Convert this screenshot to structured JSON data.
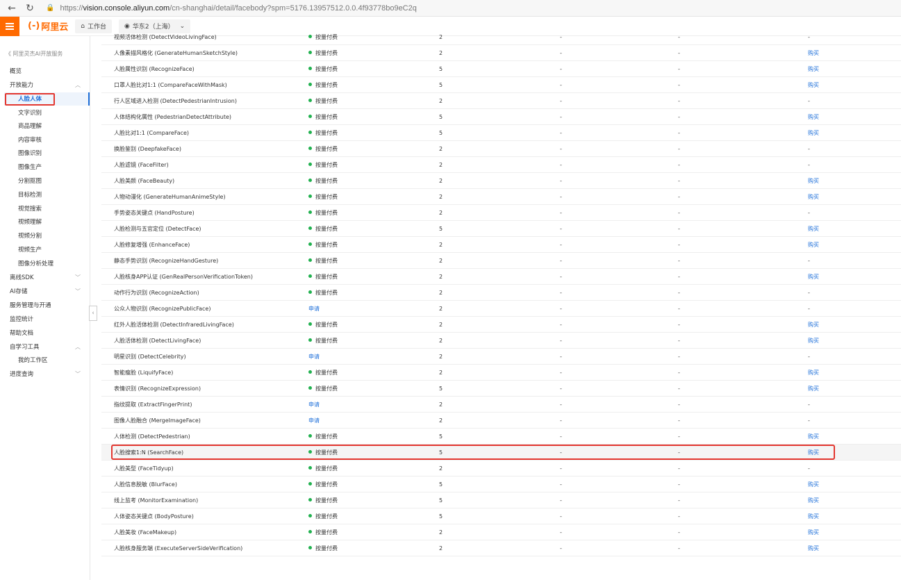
{
  "browser": {
    "url_prefix": "https://",
    "url_host": "vision.console.aliyun.com",
    "url_rest": "/cn-shanghai/detail/facebody?spm=5176.13957512.0.0.4f93778bo9eC2q"
  },
  "topbar": {
    "logo_mark": "(-)",
    "logo_text": "阿里云",
    "workbench": "工作台",
    "region": "华东2（上海）"
  },
  "sidebar": {
    "back": "《 阿里灵杰AI开放服务",
    "items": [
      {
        "label": "概览",
        "child": false
      },
      {
        "label": "开放能力",
        "child": false,
        "arrow": "︿"
      },
      {
        "label": "人脸人体",
        "child": true,
        "active": true
      },
      {
        "label": "文字识别",
        "child": true
      },
      {
        "label": "商品理解",
        "child": true
      },
      {
        "label": "内容审核",
        "child": true
      },
      {
        "label": "图像识别",
        "child": true
      },
      {
        "label": "图像生产",
        "child": true
      },
      {
        "label": "分割抠图",
        "child": true
      },
      {
        "label": "目标检测",
        "child": true
      },
      {
        "label": "视觉搜索",
        "child": true
      },
      {
        "label": "视频理解",
        "child": true
      },
      {
        "label": "视频分割",
        "child": true
      },
      {
        "label": "视频生产",
        "child": true
      },
      {
        "label": "图像分析处理",
        "child": true
      },
      {
        "label": "离线SDK",
        "child": false,
        "arrow": "﹀"
      },
      {
        "label": "AI存储",
        "child": false,
        "arrow": "﹀"
      },
      {
        "label": "服务管理与开通",
        "child": false
      },
      {
        "label": "监控统计",
        "child": false
      },
      {
        "label": "帮助文档",
        "child": false
      },
      {
        "label": "自学习工具",
        "child": false,
        "arrow": "︿"
      },
      {
        "label": "我的工作区",
        "child": true
      },
      {
        "label": "进度查询",
        "child": false,
        "arrow": "﹀"
      }
    ]
  },
  "table": {
    "rows": [
      {
        "name": "视频活体检测 (DetectVideoLivingFace)",
        "bill": "按量付费",
        "paid": true,
        "qps": "2",
        "d1": "-",
        "d2": "-",
        "buy": "-"
      },
      {
        "name": "人像素描风格化 (GenerateHumanSketchStyle)",
        "bill": "按量付费",
        "paid": true,
        "qps": "2",
        "d1": "-",
        "d2": "-",
        "buy": "购买"
      },
      {
        "name": "人脸属性识别 (RecognizeFace)",
        "bill": "按量付费",
        "paid": true,
        "qps": "5",
        "d1": "-",
        "d2": "-",
        "buy": "购买"
      },
      {
        "name": "口罩人脸比对1:1 (CompareFaceWithMask)",
        "bill": "按量付费",
        "paid": true,
        "qps": "5",
        "d1": "-",
        "d2": "-",
        "buy": "购买"
      },
      {
        "name": "行人区域进入检测 (DetectPedestrianIntrusion)",
        "bill": "按量付费",
        "paid": true,
        "qps": "2",
        "d1": "-",
        "d2": "-",
        "buy": "-"
      },
      {
        "name": "人体结构化属性 (PedestrianDetectAttribute)",
        "bill": "按量付费",
        "paid": true,
        "qps": "5",
        "d1": "-",
        "d2": "-",
        "buy": "购买"
      },
      {
        "name": "人脸比对1:1 (CompareFace)",
        "bill": "按量付费",
        "paid": true,
        "qps": "5",
        "d1": "-",
        "d2": "-",
        "buy": "购买"
      },
      {
        "name": "换脸鉴别 (DeepfakeFace)",
        "bill": "按量付费",
        "paid": true,
        "qps": "2",
        "d1": "-",
        "d2": "-",
        "buy": "-"
      },
      {
        "name": "人脸滤镜 (FaceFilter)",
        "bill": "按量付费",
        "paid": true,
        "qps": "2",
        "d1": "-",
        "d2": "-",
        "buy": "-"
      },
      {
        "name": "人脸美颜 (FaceBeauty)",
        "bill": "按量付费",
        "paid": true,
        "qps": "2",
        "d1": "-",
        "d2": "-",
        "buy": "购买"
      },
      {
        "name": "人物动漫化 (GenerateHumanAnimeStyle)",
        "bill": "按量付费",
        "paid": true,
        "qps": "2",
        "d1": "-",
        "d2": "-",
        "buy": "购买"
      },
      {
        "name": "手势姿态关键点 (HandPosture)",
        "bill": "按量付费",
        "paid": true,
        "qps": "2",
        "d1": "-",
        "d2": "-",
        "buy": "-"
      },
      {
        "name": "人脸检测与五官定位 (DetectFace)",
        "bill": "按量付费",
        "paid": true,
        "qps": "5",
        "d1": "-",
        "d2": "-",
        "buy": "购买"
      },
      {
        "name": "人脸修复增强 (EnhanceFace)",
        "bill": "按量付费",
        "paid": true,
        "qps": "2",
        "d1": "-",
        "d2": "-",
        "buy": "购买"
      },
      {
        "name": "静态手势识别 (RecognizeHandGesture)",
        "bill": "按量付费",
        "paid": true,
        "qps": "2",
        "d1": "-",
        "d2": "-",
        "buy": "-"
      },
      {
        "name": "人脸核身APP认证 (GenRealPersonVerificationToken)",
        "bill": "按量付费",
        "paid": true,
        "qps": "2",
        "d1": "-",
        "d2": "-",
        "buy": "购买"
      },
      {
        "name": "动作行为识别 (RecognizeAction)",
        "bill": "按量付费",
        "paid": true,
        "qps": "2",
        "d1": "-",
        "d2": "-",
        "buy": "-"
      },
      {
        "name": "公众人物识别 (RecognizePublicFace)",
        "bill": "申请",
        "paid": false,
        "qps": "2",
        "d1": "-",
        "d2": "-",
        "buy": "-"
      },
      {
        "name": "红外人脸活体检测 (DetectInfraredLivingFace)",
        "bill": "按量付费",
        "paid": true,
        "qps": "2",
        "d1": "-",
        "d2": "-",
        "buy": "购买"
      },
      {
        "name": "人脸活体检测 (DetectLivingFace)",
        "bill": "按量付费",
        "paid": true,
        "qps": "2",
        "d1": "-",
        "d2": "-",
        "buy": "购买"
      },
      {
        "name": "明星识别 (DetectCelebrity)",
        "bill": "申请",
        "paid": false,
        "qps": "2",
        "d1": "-",
        "d2": "-",
        "buy": "-"
      },
      {
        "name": "智能瘦脸 (LiquifyFace)",
        "bill": "按量付费",
        "paid": true,
        "qps": "2",
        "d1": "-",
        "d2": "-",
        "buy": "购买"
      },
      {
        "name": "表情识别 (RecognizeExpression)",
        "bill": "按量付费",
        "paid": true,
        "qps": "5",
        "d1": "-",
        "d2": "-",
        "buy": "购买"
      },
      {
        "name": "指纹提取 (ExtractFingerPrint)",
        "bill": "申请",
        "paid": false,
        "qps": "2",
        "d1": "-",
        "d2": "-",
        "buy": "-"
      },
      {
        "name": "图像人脸融合 (MergeImageFace)",
        "bill": "申请",
        "paid": false,
        "qps": "2",
        "d1": "-",
        "d2": "-",
        "buy": "-"
      },
      {
        "name": "人体检测 (DetectPedestrian)",
        "bill": "按量付费",
        "paid": true,
        "qps": "5",
        "d1": "-",
        "d2": "-",
        "buy": "购买"
      },
      {
        "name": "人脸搜索1:N (SearchFace)",
        "bill": "按量付费",
        "paid": true,
        "qps": "5",
        "d1": "-",
        "d2": "-",
        "buy": "购买",
        "highlight": true
      },
      {
        "name": "人脸美型 (FaceTidyup)",
        "bill": "按量付费",
        "paid": true,
        "qps": "2",
        "d1": "-",
        "d2": "-",
        "buy": "-"
      },
      {
        "name": "人脸信息脱敏 (BlurFace)",
        "bill": "按量付费",
        "paid": true,
        "qps": "5",
        "d1": "-",
        "d2": "-",
        "buy": "购买"
      },
      {
        "name": "线上监考 (MonitorExamination)",
        "bill": "按量付费",
        "paid": true,
        "qps": "5",
        "d1": "-",
        "d2": "-",
        "buy": "购买"
      },
      {
        "name": "人体姿态关键点 (BodyPosture)",
        "bill": "按量付费",
        "paid": true,
        "qps": "5",
        "d1": "-",
        "d2": "-",
        "buy": "购买"
      },
      {
        "name": "人脸美妆 (FaceMakeup)",
        "bill": "按量付费",
        "paid": true,
        "qps": "2",
        "d1": "-",
        "d2": "-",
        "buy": "购买"
      },
      {
        "name": "人脸核身服务端 (ExecuteServerSideVerification)",
        "bill": "按量付费",
        "paid": true,
        "qps": "2",
        "d1": "-",
        "d2": "-",
        "buy": "购买"
      }
    ]
  },
  "colors": {
    "accent": "#ff6a00",
    "link": "#1e6fd9",
    "status_green": "#21b14f",
    "highlight_frame": "#e3362f"
  }
}
